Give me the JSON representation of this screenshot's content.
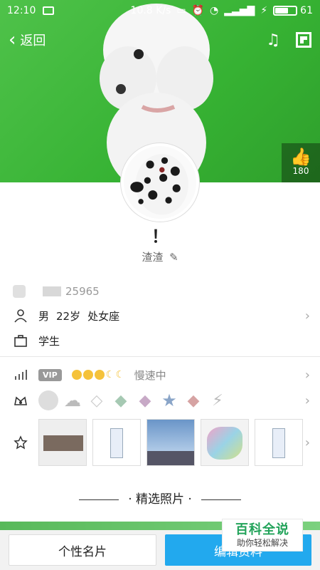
{
  "status_bar": {
    "time": "12:10",
    "net_speed": "10.8 K/s",
    "battery_percent": "61"
  },
  "nav": {
    "back_label": "返回"
  },
  "likes": {
    "count": "180"
  },
  "profile": {
    "nickname": "！",
    "remark": "渣渣",
    "account_masked": "25965"
  },
  "info": {
    "gender": "男",
    "age": "22岁",
    "zodiac": "处女座",
    "occupation": "学生"
  },
  "vip": {
    "badge": "VIP",
    "speed_label": "慢速中"
  },
  "section_title": "精选照片",
  "buttons": {
    "card": "个性名片",
    "edit": "编辑资料"
  },
  "watermark": {
    "title": "百科全说",
    "subtitle": "助你轻松解决"
  }
}
